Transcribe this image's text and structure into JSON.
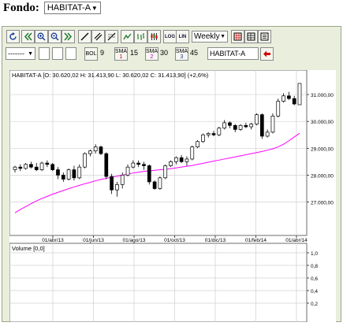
{
  "fondo": {
    "label": "Fondo:",
    "selected": "HABITAT-A"
  },
  "toolbar": {
    "period": "Weekly",
    "log_label": "LOG",
    "lin_label": "LIN",
    "line_style": "-------",
    "bol_label": "BOL",
    "bol_value": "9",
    "sma1_label": "SMA",
    "sma1_index": "1",
    "sma1_value": "15",
    "sma2_label": "SMA",
    "sma2_index": "2",
    "sma2_value": "30",
    "sma3_label": "SMA",
    "sma3_index": "3",
    "sma3_value": "45",
    "symbol": "HABITAT-A"
  },
  "chart_data": {
    "type": "candlestick",
    "header": "HABITAT-A [O: 30.620,02  H: 31.413,90  L: 30.620,02  C: 31.413,90] (+2,6%)",
    "volume_label": "Volume [0,0]",
    "x_ticks": [
      "01/abr/13",
      "01/jun/13",
      "01/ago/13",
      "01/oct/13",
      "01/dic/13",
      "01/feb/14",
      "01/abr/14"
    ],
    "y_ticks": [
      "27.000,00",
      "28.000,00",
      "29.000,00",
      "30.000,00",
      "31.000,00"
    ],
    "y_tick_values": [
      27000,
      28000,
      29000,
      30000,
      31000
    ],
    "ylim": [
      26400,
      31500
    ],
    "volume_ticks": [
      "1,0",
      "0,8",
      "0,6",
      "0,4",
      "0,2"
    ],
    "volume_tick_values": [
      1.0,
      0.8,
      0.6,
      0.4,
      0.2
    ],
    "candles": [
      {
        "o": 28200,
        "h": 28350,
        "l": 28100,
        "c": 28300
      },
      {
        "o": 28300,
        "h": 28400,
        "l": 28150,
        "c": 28250
      },
      {
        "o": 28250,
        "h": 28450,
        "l": 28200,
        "c": 28400
      },
      {
        "o": 28400,
        "h": 28500,
        "l": 28250,
        "c": 28300
      },
      {
        "o": 28300,
        "h": 28450,
        "l": 28150,
        "c": 28200
      },
      {
        "o": 28200,
        "h": 28500,
        "l": 28150,
        "c": 28450
      },
      {
        "o": 28450,
        "h": 28550,
        "l": 28300,
        "c": 28400
      },
      {
        "o": 28400,
        "h": 28450,
        "l": 28150,
        "c": 28200
      },
      {
        "o": 28200,
        "h": 28300,
        "l": 27850,
        "c": 28000
      },
      {
        "o": 28000,
        "h": 28100,
        "l": 27750,
        "c": 27850
      },
      {
        "o": 27850,
        "h": 28250,
        "l": 27800,
        "c": 28200
      },
      {
        "o": 28200,
        "h": 28350,
        "l": 27800,
        "c": 27900
      },
      {
        "o": 27900,
        "h": 28400,
        "l": 27850,
        "c": 28300
      },
      {
        "o": 28300,
        "h": 28850,
        "l": 28250,
        "c": 28800
      },
      {
        "o": 28800,
        "h": 28950,
        "l": 28700,
        "c": 28900
      },
      {
        "o": 28900,
        "h": 29150,
        "l": 28800,
        "c": 29050
      },
      {
        "o": 29050,
        "h": 29100,
        "l": 28750,
        "c": 28800
      },
      {
        "o": 28800,
        "h": 28850,
        "l": 27850,
        "c": 27950
      },
      {
        "o": 27950,
        "h": 28050,
        "l": 27300,
        "c": 27450
      },
      {
        "o": 27450,
        "h": 27750,
        "l": 27200,
        "c": 27650
      },
      {
        "o": 27650,
        "h": 28100,
        "l": 27500,
        "c": 28000
      },
      {
        "o": 28000,
        "h": 28400,
        "l": 27950,
        "c": 28300
      },
      {
        "o": 28300,
        "h": 28550,
        "l": 28250,
        "c": 28450
      },
      {
        "o": 28450,
        "h": 28550,
        "l": 28300,
        "c": 28400
      },
      {
        "o": 28400,
        "h": 28500,
        "l": 28200,
        "c": 28350
      },
      {
        "o": 28350,
        "h": 28400,
        "l": 27650,
        "c": 27750
      },
      {
        "o": 27750,
        "h": 27800,
        "l": 27450,
        "c": 27500
      },
      {
        "o": 27500,
        "h": 27950,
        "l": 27450,
        "c": 27900
      },
      {
        "o": 27900,
        "h": 28400,
        "l": 27850,
        "c": 28350
      },
      {
        "o": 28350,
        "h": 28550,
        "l": 28300,
        "c": 28500
      },
      {
        "o": 28500,
        "h": 28700,
        "l": 28400,
        "c": 28650
      },
      {
        "o": 28650,
        "h": 28750,
        "l": 28450,
        "c": 28500
      },
      {
        "o": 28500,
        "h": 28700,
        "l": 28350,
        "c": 28600
      },
      {
        "o": 28600,
        "h": 29100,
        "l": 28550,
        "c": 29050
      },
      {
        "o": 29050,
        "h": 29300,
        "l": 29000,
        "c": 29250
      },
      {
        "o": 29250,
        "h": 29550,
        "l": 29200,
        "c": 29500
      },
      {
        "o": 29500,
        "h": 29600,
        "l": 29400,
        "c": 29550
      },
      {
        "o": 29550,
        "h": 29650,
        "l": 29450,
        "c": 29500
      },
      {
        "o": 29500,
        "h": 29800,
        "l": 29450,
        "c": 29750
      },
      {
        "o": 29750,
        "h": 30050,
        "l": 29700,
        "c": 29950
      },
      {
        "o": 29950,
        "h": 30000,
        "l": 29750,
        "c": 29850
      },
      {
        "o": 29850,
        "h": 29900,
        "l": 29600,
        "c": 29700
      },
      {
        "o": 29700,
        "h": 29900,
        "l": 29650,
        "c": 29850
      },
      {
        "o": 29850,
        "h": 29950,
        "l": 29750,
        "c": 29800
      },
      {
        "o": 29800,
        "h": 29950,
        "l": 29700,
        "c": 29900
      },
      {
        "o": 29900,
        "h": 30300,
        "l": 29850,
        "c": 30250
      },
      {
        "o": 30250,
        "h": 30300,
        "l": 29350,
        "c": 29450
      },
      {
        "o": 29450,
        "h": 29700,
        "l": 29400,
        "c": 29600
      },
      {
        "o": 29600,
        "h": 30300,
        "l": 29550,
        "c": 30200
      },
      {
        "o": 30200,
        "h": 30850,
        "l": 30150,
        "c": 30750
      },
      {
        "o": 30750,
        "h": 31050,
        "l": 30700,
        "c": 30950
      },
      {
        "o": 30950,
        "h": 31100,
        "l": 30800,
        "c": 30850
      },
      {
        "o": 30850,
        "h": 30950,
        "l": 30600,
        "c": 30650
      },
      {
        "o": 30620,
        "h": 31414,
        "l": 30620,
        "c": 31414
      }
    ],
    "sma_values": [
      26600,
      26720,
      26830,
      26940,
      27040,
      27130,
      27210,
      27290,
      27360,
      27430,
      27500,
      27560,
      27620,
      27680,
      27730,
      27790,
      27840,
      27880,
      27920,
      27960,
      28000,
      28040,
      28080,
      28110,
      28140,
      28160,
      28180,
      28200,
      28220,
      28240,
      28270,
      28300,
      28330,
      28360,
      28400,
      28440,
      28480,
      28520,
      28560,
      28600,
      28640,
      28680,
      28720,
      28760,
      28800,
      28840,
      28880,
      28930,
      28980,
      29050,
      29150,
      29280,
      29420,
      29560
    ],
    "up_color": "#ffffff",
    "down_color": "#000000",
    "sma_color": "#ff00ff"
  }
}
